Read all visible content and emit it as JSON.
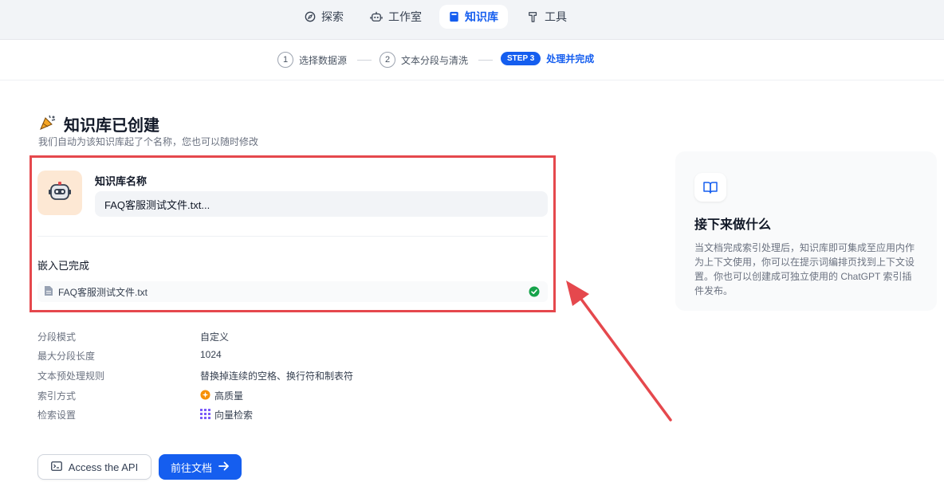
{
  "nav": {
    "items": [
      {
        "label": "探索",
        "icon": "compass-icon"
      },
      {
        "label": "工作室",
        "icon": "robot-icon"
      },
      {
        "label": "知识库",
        "icon": "book-icon",
        "active": true
      },
      {
        "label": "工具",
        "icon": "hammer-icon"
      }
    ]
  },
  "steps": [
    {
      "num": "1",
      "label": "选择数据源"
    },
    {
      "num": "2",
      "label": "文本分段与清洗"
    },
    {
      "badge": "STEP 3",
      "label": "处理并完成",
      "current": true
    }
  ],
  "header": {
    "title": "知识库已创建",
    "subtitle": "我们自动为该知识库起了个名称，您也可以随时修改"
  },
  "kb": {
    "name_label": "知识库名称",
    "name_value": "FAQ客服测试文件.txt..."
  },
  "embed": {
    "title": "嵌入已完成",
    "file": "FAQ客服测试文件.txt",
    "status": "completed"
  },
  "settings": [
    {
      "key": "分段模式",
      "value": "自定义"
    },
    {
      "key": "最大分段长度",
      "value": "1024"
    },
    {
      "key": "文本预处理规则",
      "value": "替换掉连续的空格、换行符和制表符"
    },
    {
      "key": "索引方式",
      "value": "高质量",
      "icon": "orange-star-icon"
    },
    {
      "key": "检索设置",
      "value": "向量检索",
      "icon": "grid-icon"
    }
  ],
  "buttons": {
    "api": "Access the API",
    "docs": "前往文档"
  },
  "side": {
    "title": "接下来做什么",
    "desc": "当文档完成索引处理后，知识库即可集成至应用内作为上下文使用，你可以在提示词编排页找到上下文设置。你也可以创建成可独立使用的 ChatGPT 索引插件发布。"
  },
  "colors": {
    "accent": "#155eef",
    "highlight_border": "#e5484d",
    "success": "#16a34a"
  }
}
